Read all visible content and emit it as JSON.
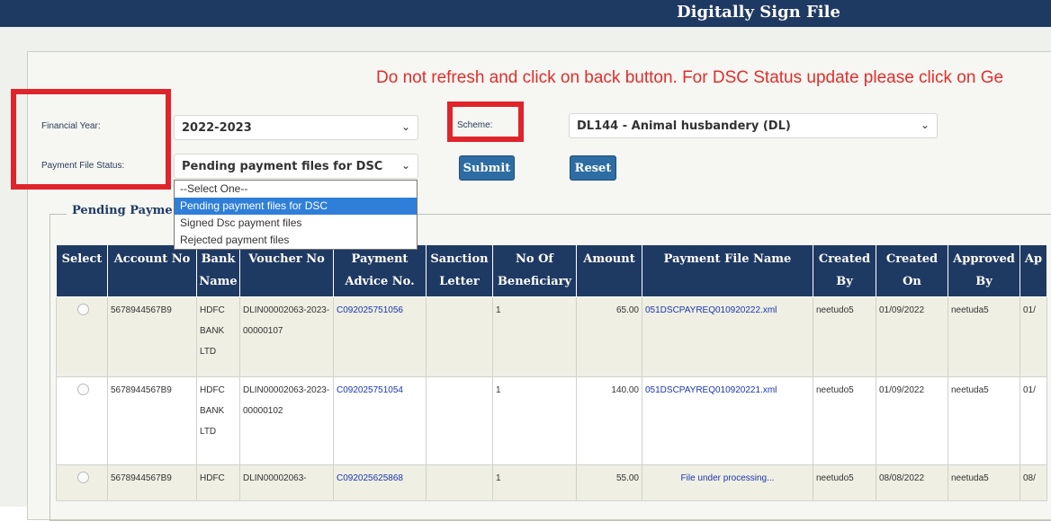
{
  "header": {
    "title": "Digitally Sign File"
  },
  "warning": "Do not refresh and click on back button. For DSC Status update please click on Ge",
  "filters": {
    "financial_year_label": "Financial Year:",
    "financial_year_value": "2022-2023",
    "payment_file_status_label": "Payment File Status:",
    "payment_file_status_value": "Pending payment files for DSC",
    "scheme_label": "Scheme:",
    "scheme_value": "DL144 - Animal husbandery (DL)",
    "submit_label": "Submit",
    "reset_label": "Reset",
    "status_options": [
      "--Select One--",
      "Pending payment files for DSC",
      "Signed Dsc payment files",
      "Rejected payment files"
    ],
    "status_selected_index": 1
  },
  "section_title": "Pending Payme",
  "table": {
    "headers": [
      "Select",
      "Account No",
      "Bank Name",
      "Voucher No",
      "Payment Advice No.",
      "Sanction Letter",
      "No Of Beneficiary",
      "Amount",
      "Payment File Name",
      "Created By",
      "Created On",
      "Approved By",
      "Ap"
    ],
    "rows": [
      {
        "account_no": "5678944567B9",
        "bank_name": "HDFC BANK LTD",
        "voucher_no": "DLIN00002063-2023-00000107",
        "payment_advice_no": "C092025751056",
        "sanction_letter": "",
        "no_of_beneficiary": "1",
        "amount": "65.00",
        "payment_file_name": "051DSCPAYREQ010920222.xml",
        "created_by": "neetudo5",
        "created_on": "01/09/2022",
        "approved_by": "neetuda5",
        "ap": "01/"
      },
      {
        "account_no": "5678944567B9",
        "bank_name": "HDFC BANK LTD",
        "voucher_no": "DLIN00002063-2023-00000102",
        "payment_advice_no": "C092025751054",
        "sanction_letter": "",
        "no_of_beneficiary": "1",
        "amount": "140.00",
        "payment_file_name": "051DSCPAYREQ010920221.xml",
        "created_by": "neetudo5",
        "created_on": "01/09/2022",
        "approved_by": "neetuda5",
        "ap": "01/"
      },
      {
        "account_no": "5678944567B9",
        "bank_name": "HDFC",
        "voucher_no": "DLIN00002063-",
        "payment_advice_no": "C092025625868",
        "sanction_letter": "",
        "no_of_beneficiary": "1",
        "amount": "55.00",
        "payment_file_name": "File under processing...",
        "created_by": "neetudo5",
        "created_on": "08/08/2022",
        "approved_by": "neetuda5",
        "ap": "08/"
      }
    ]
  },
  "colors": {
    "header_bg": "#1f3a62",
    "warning": "#e32d2d",
    "highlight_box": "#e0242b",
    "button": "#2d6da3",
    "link": "#1a36b0"
  }
}
